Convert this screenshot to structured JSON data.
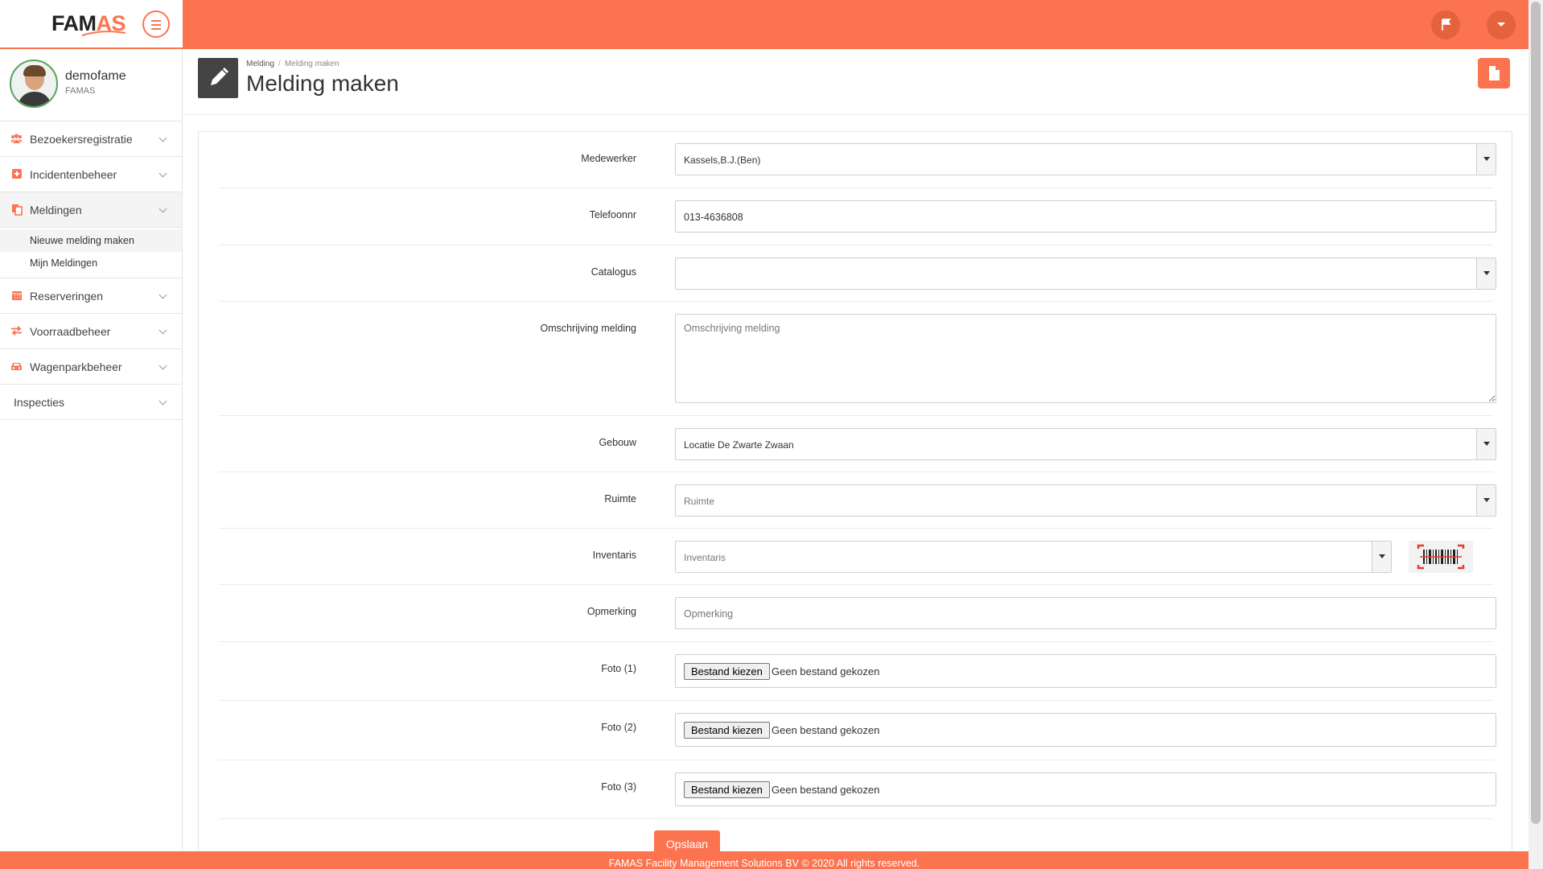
{
  "app": {
    "logo_text_1": "FAM",
    "logo_text_2": "AS"
  },
  "user": {
    "name": "demofame",
    "org": "FAMAS"
  },
  "sidebar": {
    "items": [
      {
        "label": "Bezoekersregistratie",
        "icon": "users-icon"
      },
      {
        "label": "Incidentenbeheer",
        "icon": "plus-square-icon"
      },
      {
        "label": "Meldingen",
        "icon": "files-icon"
      },
      {
        "label": "Reserveringen",
        "icon": "calendar-icon"
      },
      {
        "label": "Voorraadbeheer",
        "icon": "exchange-icon"
      },
      {
        "label": "Wagenparkbeheer",
        "icon": "car-icon"
      },
      {
        "label": "Inspecties",
        "icon": ""
      }
    ],
    "submenu": [
      "Nieuwe melding maken",
      "Mijn Meldingen"
    ]
  },
  "header": {
    "breadcrumb": [
      "Melding",
      "Melding maken"
    ],
    "title": "Melding maken"
  },
  "form": {
    "medewerker": {
      "label": "Medewerker",
      "value": "Kassels,B.J.(Ben)"
    },
    "telefoonnr": {
      "label": "Telefoonnr",
      "value": "013-4636808"
    },
    "catalogus": {
      "label": "Catalogus",
      "value": ""
    },
    "omschrijving": {
      "label": "Omschrijving melding",
      "placeholder": "Omschrijving melding"
    },
    "gebouw": {
      "label": "Gebouw",
      "value": "Locatie De Zwarte Zwaan"
    },
    "ruimte": {
      "label": "Ruimte",
      "placeholder": "Ruimte"
    },
    "inventaris": {
      "label": "Inventaris",
      "placeholder": "Inventaris"
    },
    "opmerking": {
      "label": "Opmerking",
      "placeholder": "Opmerking"
    },
    "fotos": [
      {
        "label": "Foto (1)",
        "button": "Bestand kiezen",
        "status": "Geen bestand gekozen"
      },
      {
        "label": "Foto (2)",
        "button": "Bestand kiezen",
        "status": "Geen bestand gekozen"
      },
      {
        "label": "Foto (3)",
        "button": "Bestand kiezen",
        "status": "Geen bestand gekozen"
      }
    ],
    "save_label": "Opslaan"
  },
  "footer": {
    "text": "FAMAS Facility Management Solutions BV © 2020 All rights reserved."
  },
  "colors": {
    "accent": "#fc7350",
    "dark": "#444444"
  }
}
